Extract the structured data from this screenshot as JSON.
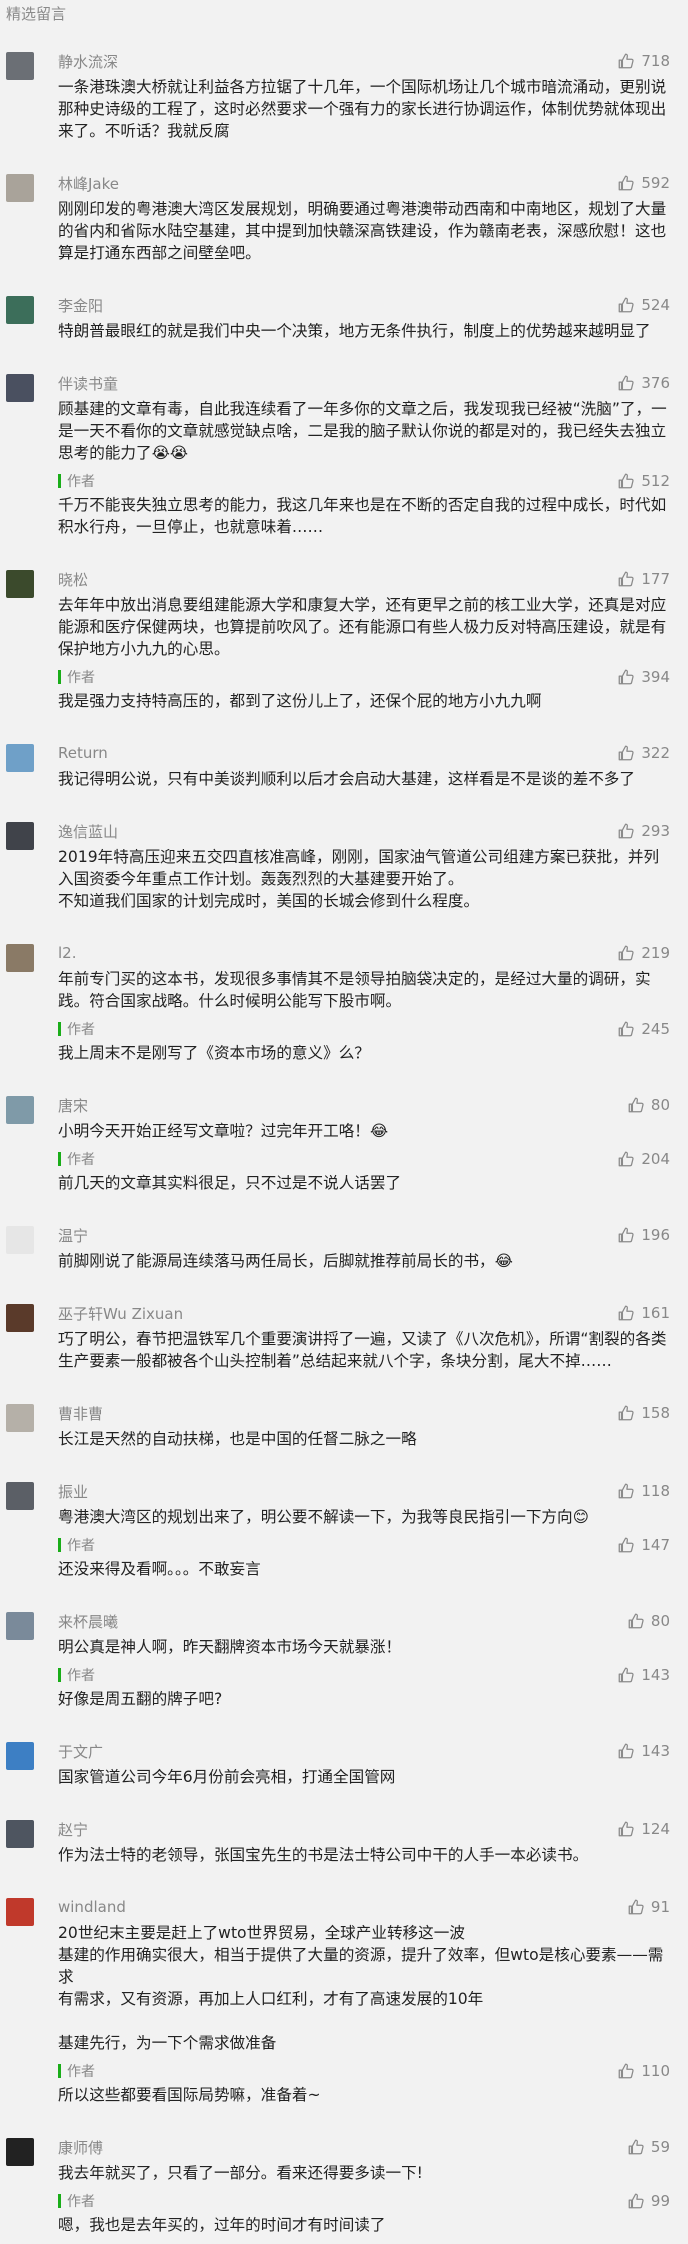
{
  "section_title": "精选留言",
  "author_label": "作者",
  "comments": [
    {
      "nickname": "静水流深",
      "likes": "718",
      "avatar_color": "#6b6f75",
      "content": "一条港珠澳大桥就让利益各方拉锯了十几年，一个国际机场让几个城市暗流涌动，更别说那种史诗级的工程了，这时必然要求一个强有力的家长进行协调运作，体制优势就体现出来了。不听话？我就反腐"
    },
    {
      "nickname": "林峰Jake",
      "likes": "592",
      "avatar_color": "#a9a39a",
      "content": "刚刚印发的粤港澳大湾区发展规划，明确要通过粤港澳带动西南和中南地区，规划了大量的省内和省际水陆空基建，其中提到加快赣深高铁建设，作为赣南老表，深感欣慰！这也算是打通东西部之间壁垒吧。"
    },
    {
      "nickname": "李金阳",
      "likes": "524",
      "avatar_color": "#3c6e5a",
      "content": "特朗普最眼红的就是我们中央一个决策，地方无条件执行，制度上的优势越来越明显了"
    },
    {
      "nickname": "伴读书童",
      "likes": "376",
      "avatar_color": "#4a5060",
      "content": "顾基建的文章有毒，自此我连续看了一年多你的文章之后，我发现我已经被“洗脑”了，一是一天不看你的文章就感觉缺点啥，二是我的脑子默认你说的都是对的，我已经失去独立思考的能力了😭😭",
      "reply": {
        "likes": "512",
        "content": "千万不能丧失独立思考的能力，我这几年来也是在不断的否定自我的过程中成长，时代如积水行舟，一旦停止，也就意味着……"
      }
    },
    {
      "nickname": "晓松",
      "likes": "177",
      "avatar_color": "#3b4a2c",
      "content": "去年年中放出消息要组建能源大学和康复大学，还有更早之前的核工业大学，还真是对应能源和医疗保健两块，也算提前吹风了。还有能源口有些人极力反对特高压建设，就是有保护地方小九九的心思。",
      "reply": {
        "likes": "394",
        "content": "我是强力支持特高压的，都到了这份儿上了，还保个屁的地方小九九啊"
      }
    },
    {
      "nickname": "Return",
      "likes": "322",
      "avatar_color": "#6fa0c8",
      "content": "我记得明公说，只有中美谈判顺利以后才会启动大基建，这样看是不是谈的差不多了"
    },
    {
      "nickname": "逸信蓝山",
      "likes": "293",
      "avatar_color": "#40434a",
      "content": "2019年特高压迎来五交四直核准高峰，刚刚，国家油气管道公司组建方案已获批，并列入国资委今年重点工作计划。轰轰烈烈的大基建要开始了。\n不知道我们国家的计划完成时，美国的长城会修到什么程度。"
    },
    {
      "nickname": "l2.",
      "likes": "219",
      "avatar_color": "#8a7a66",
      "content": "年前专门买的这本书，发现很多事情其不是领导拍脑袋决定的，是经过大量的调研，实践。符合国家战略。什么时候明公能写下股市啊。",
      "reply": {
        "likes": "245",
        "content": "我上周末不是刚写了《资本市场的意义》么？"
      }
    },
    {
      "nickname": "唐宋",
      "likes": "80",
      "avatar_color": "#7f9aa8",
      "content": "小明今天开始正经写文章啦？过完年开工咯！😂",
      "reply": {
        "likes": "204",
        "content": "前几天的文章其实料很足，只不过是不说人话罢了"
      }
    },
    {
      "nickname": "温宁",
      "likes": "196",
      "avatar_color": "#e6e6e6",
      "content": "前脚刚说了能源局连续落马两任局长，后脚就推荐前局长的书，😂"
    },
    {
      "nickname": "巫子轩Wu Zixuan",
      "likes": "161",
      "avatar_color": "#5a3a2a",
      "content": "巧了明公，春节把温铁军几个重要演讲捋了一遍，又读了《八次危机》，所谓“割裂的各类生产要素一般都被各个山头控制着”总结起来就八个字，条块分割，尾大不掉……"
    },
    {
      "nickname": "曹非曹",
      "likes": "158",
      "avatar_color": "#b5b0a8",
      "content": "长江是天然的自动扶梯，也是中国的任督二脉之一略"
    },
    {
      "nickname": "振业",
      "likes": "118",
      "avatar_color": "#5b5f66",
      "content": "粤港澳大湾区的规划出来了，明公要不解读一下，为我等良民指引一下方向😊",
      "reply": {
        "likes": "147",
        "content": "还没来得及看啊。。。不敢妄言"
      }
    },
    {
      "nickname": "来杯晨曦",
      "likes": "80",
      "avatar_color": "#7a8a9a",
      "content": "明公真是神人啊，昨天翻牌资本市场今天就暴涨！",
      "reply": {
        "likes": "143",
        "content": "好像是周五翻的牌子吧?"
      }
    },
    {
      "nickname": "于文广",
      "likes": "143",
      "avatar_color": "#3d7fc4",
      "content": "国家管道公司今年6月份前会亮相，打通全国管网"
    },
    {
      "nickname": "赵宁",
      "likes": "124",
      "avatar_color": "#4e5560",
      "content": "作为法士特的老领导，张国宝先生的书是法士特公司中干的人手一本必读书。"
    },
    {
      "nickname": "windland",
      "likes": "91",
      "avatar_color": "#c0392b",
      "content": "20世纪末主要是赶上了wto世界贸易，全球产业转移这一波\n基建的作用确实很大，相当于提供了大量的资源，提升了效率，但wto是核心要素——需求\n有需求，又有资源，再加上人口红利，才有了高速发展的10年\n\n基建先行，为一下个需求做准备",
      "reply": {
        "likes": "110",
        "content": "所以这些都要看国际局势嘛，准备着~"
      }
    },
    {
      "nickname": "康师傅",
      "likes": "59",
      "avatar_color": "#222222",
      "content": "我去年就买了，只看了一部分。看来还得要多读一下!",
      "reply": {
        "likes": "99",
        "content": "嗯，我也是去年买的，过年的时间才有时间读了"
      }
    }
  ]
}
